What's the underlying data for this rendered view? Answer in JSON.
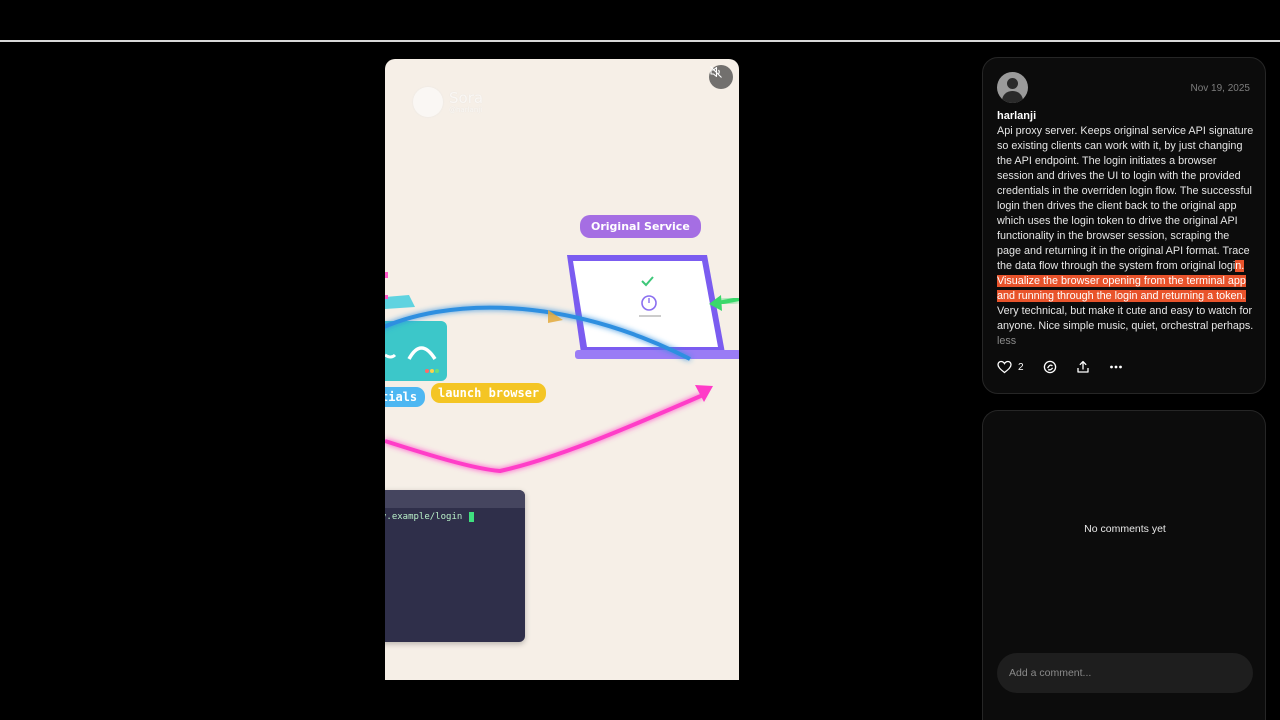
{
  "video": {
    "watermark_brand": "Sora",
    "watermark_user": "@harlanji",
    "label_original_service": "Original Service",
    "label_launch_browser": "launch browser",
    "label_credentials": "tials",
    "terminal_text": "v.example/login"
  },
  "post": {
    "date": "Nov 19, 2025",
    "username": "harlanji",
    "text_before": "Api proxy server. Keeps original service API signature so existing clients can work with it, by just changing the API endpoint. The login initiates a browser session and drives the UI to login with the provided credentials in the overriden login flow. The successful login then drives the client back to the original app which uses the login token to drive the original API functionality in the browser session, scraping the page and returning it in the original API format. Trace the data flow through the system from original logi",
    "text_highlight": "n. Visualize the browser opening from the terminal app and running through the login and returning a token.",
    "text_after": " Very technical, but make it cute and easy to watch for anyone. Nice simple music, quiet, orchestral perhaps.",
    "less_label": "less",
    "like_count": "2"
  },
  "comments": {
    "empty_text": "No comments yet",
    "input_placeholder": "Add a comment..."
  },
  "colors": {
    "highlight": "#e8532b",
    "laptop": "#7b5cf0",
    "arrow_blue": "#2f8fe0",
    "arrow_pink": "#ff3cc8",
    "pill_purple": "#a56ee3",
    "pill_yellow": "#f4c524"
  },
  "icons": {
    "mute": "speaker-muted-icon",
    "like": "heart-icon",
    "remix": "remix-icon",
    "share": "share-icon",
    "more": "more-dots-icon"
  }
}
